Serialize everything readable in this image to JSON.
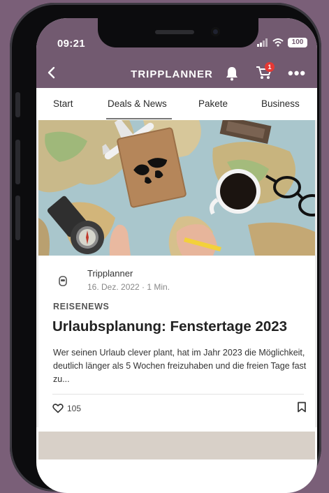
{
  "status_bar": {
    "time": "09:21",
    "battery": "100"
  },
  "header": {
    "title": "TRIPPLANNER",
    "cart_badge": "1"
  },
  "tabs": [
    {
      "label": "Start"
    },
    {
      "label": "Deals & News",
      "active": true
    },
    {
      "label": "Pakete"
    },
    {
      "label": "Business"
    }
  ],
  "post": {
    "author": "Tripplanner",
    "date": "16. Dez. 2022 · 1 Min.",
    "category": "REISENEWS",
    "title": "Urlaubsplanung: Fenstertage 2023",
    "excerpt": "Wer seinen Urlaub clever plant, hat im Jahr 2023 die Möglichkeit, deutlich länger als 5 Wochen freizuhaben und die freien Tage fast zu...",
    "likes": "105"
  },
  "colors": {
    "brand": "#725a70",
    "background": "#7a5f78",
    "badge": "#e53935"
  },
  "icons": [
    "back-icon",
    "bell-icon",
    "cart-icon",
    "more-icon",
    "author-icon",
    "heart-icon",
    "bookmark-icon",
    "signal-icon",
    "wifi-icon"
  ]
}
